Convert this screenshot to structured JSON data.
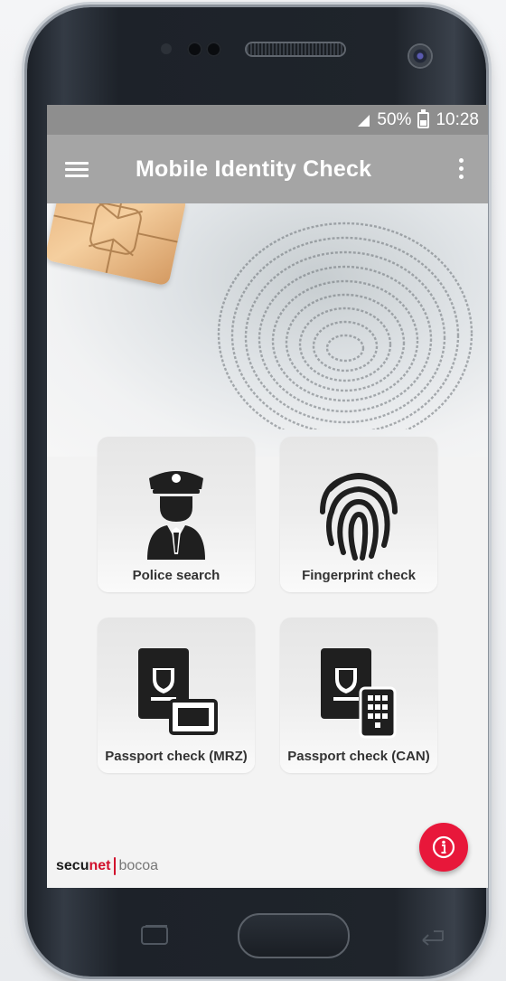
{
  "status_bar": {
    "battery": "50%",
    "time": "10:28"
  },
  "app_bar": {
    "title": "Mobile Identity Check"
  },
  "tiles": [
    {
      "label": "Police search",
      "icon": "police-officer-icon"
    },
    {
      "label": "Fingerprint check",
      "icon": "fingerprint-icon"
    },
    {
      "label": "Passport check (MRZ)",
      "icon": "passport-mrz-icon"
    },
    {
      "label": "Passport check (CAN)",
      "icon": "passport-can-icon"
    }
  ],
  "brand": {
    "part1_a": "secu",
    "part1_b": "net",
    "part2": "bocoa"
  },
  "colors": {
    "status_bar": "#8e8e8e",
    "app_bar": "#a5a5a5",
    "fab": "#e8173a",
    "brand_red": "#d1102c"
  }
}
